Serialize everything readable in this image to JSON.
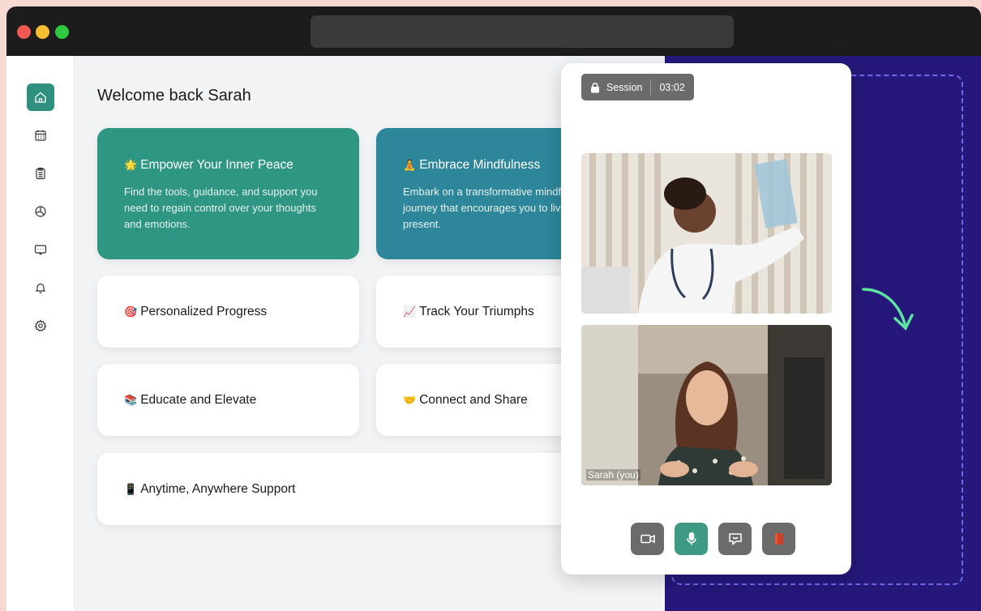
{
  "app": {
    "welcome": "Welcome back Sarah"
  },
  "sidebar": {
    "items": [
      {
        "icon": "home-icon",
        "active": true
      },
      {
        "icon": "calendar-icon"
      },
      {
        "icon": "clipboard-icon"
      },
      {
        "icon": "pie-chart-icon"
      },
      {
        "icon": "message-icon"
      },
      {
        "icon": "bell-icon"
      },
      {
        "icon": "settings-icon"
      }
    ]
  },
  "cards": {
    "peace": {
      "emoji": "🌟",
      "title": "Empower Your Inner Peace",
      "desc": "Find the tools, guidance, and support you need to regain control over your thoughts and emotions."
    },
    "mindfulness": {
      "emoji": "🧘",
      "title": "Embrace Mindfulness",
      "desc": "Embark on a transformative mindfulness journey that encourages you to live in the present."
    },
    "progress": {
      "emoji": "🎯",
      "title": "Personalized Progress"
    },
    "triumphs": {
      "emoji": "📈",
      "title": "Track Your Triumphs"
    },
    "educate": {
      "emoji": "📚",
      "title": "Educate and Elevate"
    },
    "connect": {
      "emoji": "🤝",
      "title": "Connect and Share"
    },
    "support": {
      "emoji": "📱",
      "title": "Anytime, Anywhere Support"
    }
  },
  "call": {
    "session_label": "Session",
    "timer": "03:02",
    "self_name": "Sarah (you)",
    "controls": [
      "camera-icon",
      "microphone-icon",
      "chat-icon",
      "leave-icon"
    ]
  },
  "colors": {
    "accent_teal": "#2e9683",
    "accent_blue": "#2d869a",
    "panel_bg": "#25187a",
    "arrow": "#5ee3a0"
  }
}
